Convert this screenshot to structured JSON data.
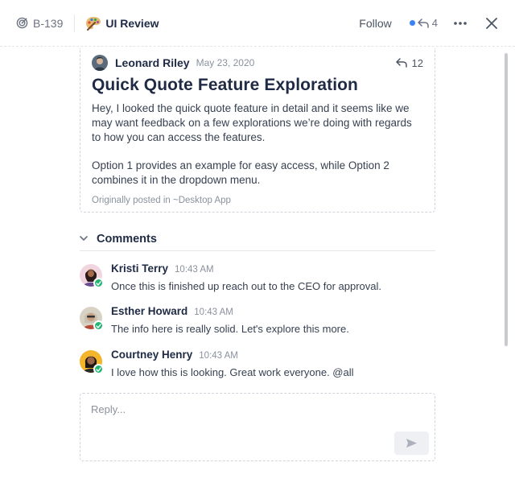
{
  "header": {
    "ticket_id": "B-139",
    "project_name": "UI Review",
    "follow_label": "Follow",
    "reply_count": "4"
  },
  "post": {
    "author": "Leonard Riley",
    "date": "May 23, 2020",
    "reply_count": "12",
    "title": "Quick Quote Feature Exploration",
    "paragraphs": [
      "Hey, I looked the quick quote feature in detail and it seems like we may want feedback on a few explorations we’re doing with regards to how you can access the features.",
      "Option 1 provides an example for easy access, while Option 2 combines it in the dropdown menu."
    ],
    "origin": "Originally posted in ~Desktop App"
  },
  "comments_section": {
    "title": "Comments",
    "items": [
      {
        "name": "Kristi Terry",
        "time": "10:43 AM",
        "text": "Once this is finished up reach out to the CEO for approval."
      },
      {
        "name": "Esther Howard",
        "time": "10:43 AM",
        "text": "The info here is really solid. Let's explore this more."
      },
      {
        "name": "Courtney Henry",
        "time": "10:43 AM",
        "text": "I love how this is looking. Great work everyone. @all"
      }
    ]
  },
  "reply": {
    "placeholder": "Reply..."
  },
  "colors": {
    "accent_dot": "#3b82f6",
    "online_badge": "#22b573",
    "heading": "#1f2a44"
  }
}
